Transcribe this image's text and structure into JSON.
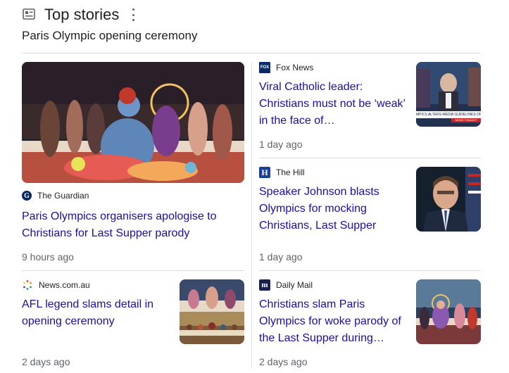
{
  "header": {
    "title": "Top stories",
    "subheading": "Paris Olympic opening ceremony"
  },
  "stories": [
    {
      "source": "The Guardian",
      "headline": "Paris Olympics organisers apologise to Christians for Last Supper parody",
      "time": "9 hours ago",
      "icon": "guardian-logo-icon"
    },
    {
      "source": "Fox News",
      "headline": "Viral Catholic leader: Christians must not be ‘weak’ in the face of…",
      "time": "1 day ago",
      "icon": "fox-news-logo-icon",
      "thumb_ticker": "MPICS ALTERS MEDIA GUIDELINES ON TRAN",
      "thumb_tag": "NEWS TONIGHT"
    },
    {
      "source": "The Hill",
      "headline": "Speaker Johnson blasts Olympics for mocking Christians, Last Supper",
      "time": "1 day ago",
      "icon": "the-hill-logo-icon"
    },
    {
      "source": "News.com.au",
      "headline": "AFL legend slams detail in opening ceremony",
      "time": "2 days ago",
      "icon": "news-com-au-logo-icon"
    },
    {
      "source": "Daily Mail",
      "headline": "Christians slam Paris Olympics for woke parody of the Last Supper during…",
      "time": "2 days ago",
      "icon": "daily-mail-logo-icon"
    }
  ],
  "colors": {
    "link": "#1a0dab",
    "meta": "#5f6368",
    "divider": "#dadce0"
  }
}
